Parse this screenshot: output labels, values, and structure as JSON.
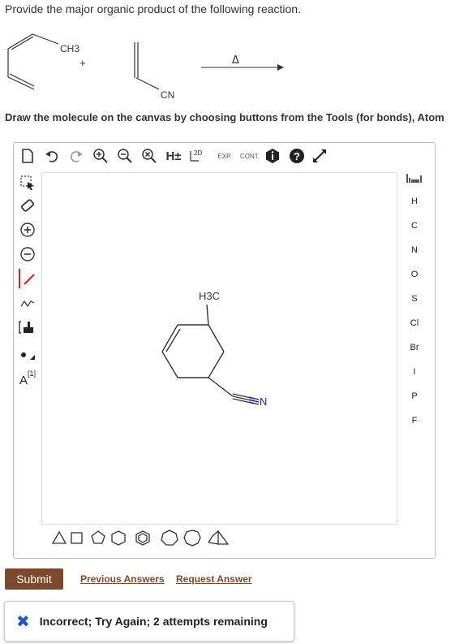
{
  "question": {
    "text": "Provide the major organic product of the following reaction."
  },
  "reaction": {
    "reactant1_group": "CH3",
    "plus": "+",
    "reactant2_group": "CN",
    "condition": "Δ"
  },
  "instructions": "Draw the molecule on the canvas by choosing buttons from the Tools (for bonds), Atom",
  "toolbar": {
    "h_toggle": "H±",
    "exp_label": "EXP.",
    "cont_label": "CONT.",
    "twod_label": "2D"
  },
  "left_tools": {
    "atom_label": "A",
    "atom_index": "[1]"
  },
  "atom_panel": [
    "H",
    "C",
    "N",
    "O",
    "S",
    "Cl",
    "Br",
    "I",
    "P",
    "F"
  ],
  "canvas_molecule": {
    "methyl_label": "H3C",
    "nitrile_label": "N"
  },
  "actions": {
    "submit": "Submit",
    "previous_answers": "Previous Answers",
    "request_answer": "Request Answer"
  },
  "feedback": {
    "message": "Incorrect; Try Again; 2 attempts remaining"
  },
  "colors": {
    "accent": "#7b4a2e",
    "error": "#2255cc",
    "nitrogen": "#1a1aa6",
    "red_bond": "#cc2222"
  }
}
